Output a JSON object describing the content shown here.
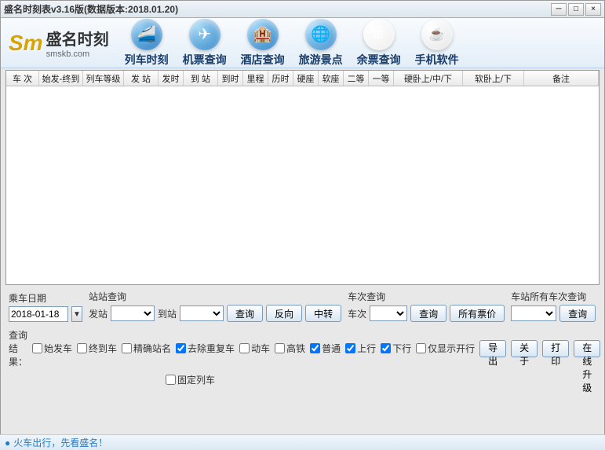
{
  "title": "盛名时刻表v3.16版(数据版本:2018.01.20)",
  "logo": {
    "cn": "盛名时刻",
    "url": "smskb.com"
  },
  "nav": {
    "train_schedule": "列车时刻",
    "ticket_query": "机票查询",
    "hotel_query": "酒店查询",
    "tourist_spots": "旅游景点",
    "remaining_tickets": "余票查询",
    "mobile_software": "手机软件"
  },
  "columns": {
    "train_no": "车 次",
    "start_end": "始发-终到",
    "train_class": "列车等级",
    "dep_station": "发 站",
    "dep_time": "发时",
    "arr_station": "到 站",
    "arr_time": "到时",
    "distance": "里程",
    "duration": "历时",
    "hard_seat": "硬座",
    "soft_seat": "软座",
    "second_class": "二等",
    "first_class": "一等",
    "hard_sleeper": "硬卧上/中/下",
    "soft_sleeper": "软卧上/下",
    "remark": "备注"
  },
  "controls": {
    "date_label": "乘车日期",
    "date_value": "2018-01-18",
    "station_query_label": "站站查询",
    "dep_label": "发站",
    "arr_label": "到站",
    "query_btn": "查询",
    "reverse_btn": "反向",
    "transfer_btn": "中转",
    "train_query_label": "车次查询",
    "train_no_label": "车次",
    "all_price_btn": "所有票价",
    "station_all_label": "车站所有车次查询",
    "result_label": "查询结果：",
    "cb_dep": "始发车",
    "cb_arr": "终到车",
    "cb_exact": "精确站名",
    "cb_dedup": "去除重复车",
    "cb_emu": "动车",
    "cb_hsr": "高铁",
    "cb_normal": "普通",
    "cb_up": "上行",
    "cb_down": "下行",
    "cb_only_show": "仅显示开行",
    "cb_fixed": "固定列车",
    "export_btn": "导出",
    "about_btn": "关于",
    "print_btn": "打印",
    "update_btn": "在线升级"
  },
  "footer": "火车出行，先看盛名！"
}
